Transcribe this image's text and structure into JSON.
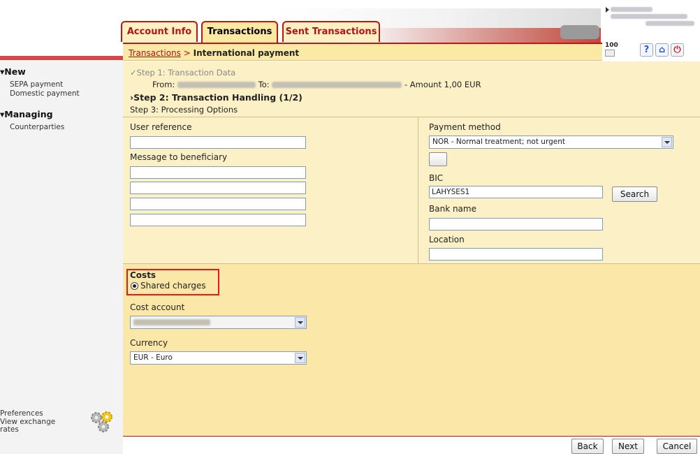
{
  "tabs": [
    {
      "label": "Account Info"
    },
    {
      "label": "Transactions"
    },
    {
      "label": "Sent Transactions"
    }
  ],
  "breadcrumb": {
    "link": "Transactions",
    "separator": ">",
    "current": "International payment"
  },
  "header": {
    "mail_count": "100"
  },
  "sidebar": {
    "new_heading": "New",
    "new_items": [
      "SEPA payment",
      "Domestic payment"
    ],
    "managing_heading": "Managing",
    "managing_items": [
      "Counterparties"
    ],
    "preferences": "Preferences",
    "exchange_rates": "View exchange rates"
  },
  "steps": {
    "step1": "Step 1: Transaction Data",
    "from_label": "From:",
    "to_label": "To:",
    "amount": "- Amount 1,00 EUR",
    "step2": "Step 2: Transaction Handling (1/2)",
    "step3": "Step 3: Processing Options"
  },
  "form": {
    "user_reference_label": "User reference",
    "message_label": "Message to beneficiary",
    "payment_method_label": "Payment method",
    "payment_method_value": "NOR - Normal treatment; not urgent",
    "bic_label": "BIC",
    "bic_value": "LAHYSES1",
    "search_label": "Search",
    "bank_name_label": "Bank name",
    "location_label": "Location",
    "costs_label": "Costs",
    "shared_charges_label": "Shared charges",
    "cost_account_label": "Cost account",
    "currency_label": "Currency",
    "currency_value": "EUR - Euro"
  },
  "footer": {
    "back": "Back",
    "next": "Next",
    "cancel": "Cancel"
  },
  "colors": {
    "brand_red": "#cc1111",
    "panel": "#fcf0c6",
    "panel_lower": "#fbe7a8",
    "step_done": "#4caf50"
  }
}
